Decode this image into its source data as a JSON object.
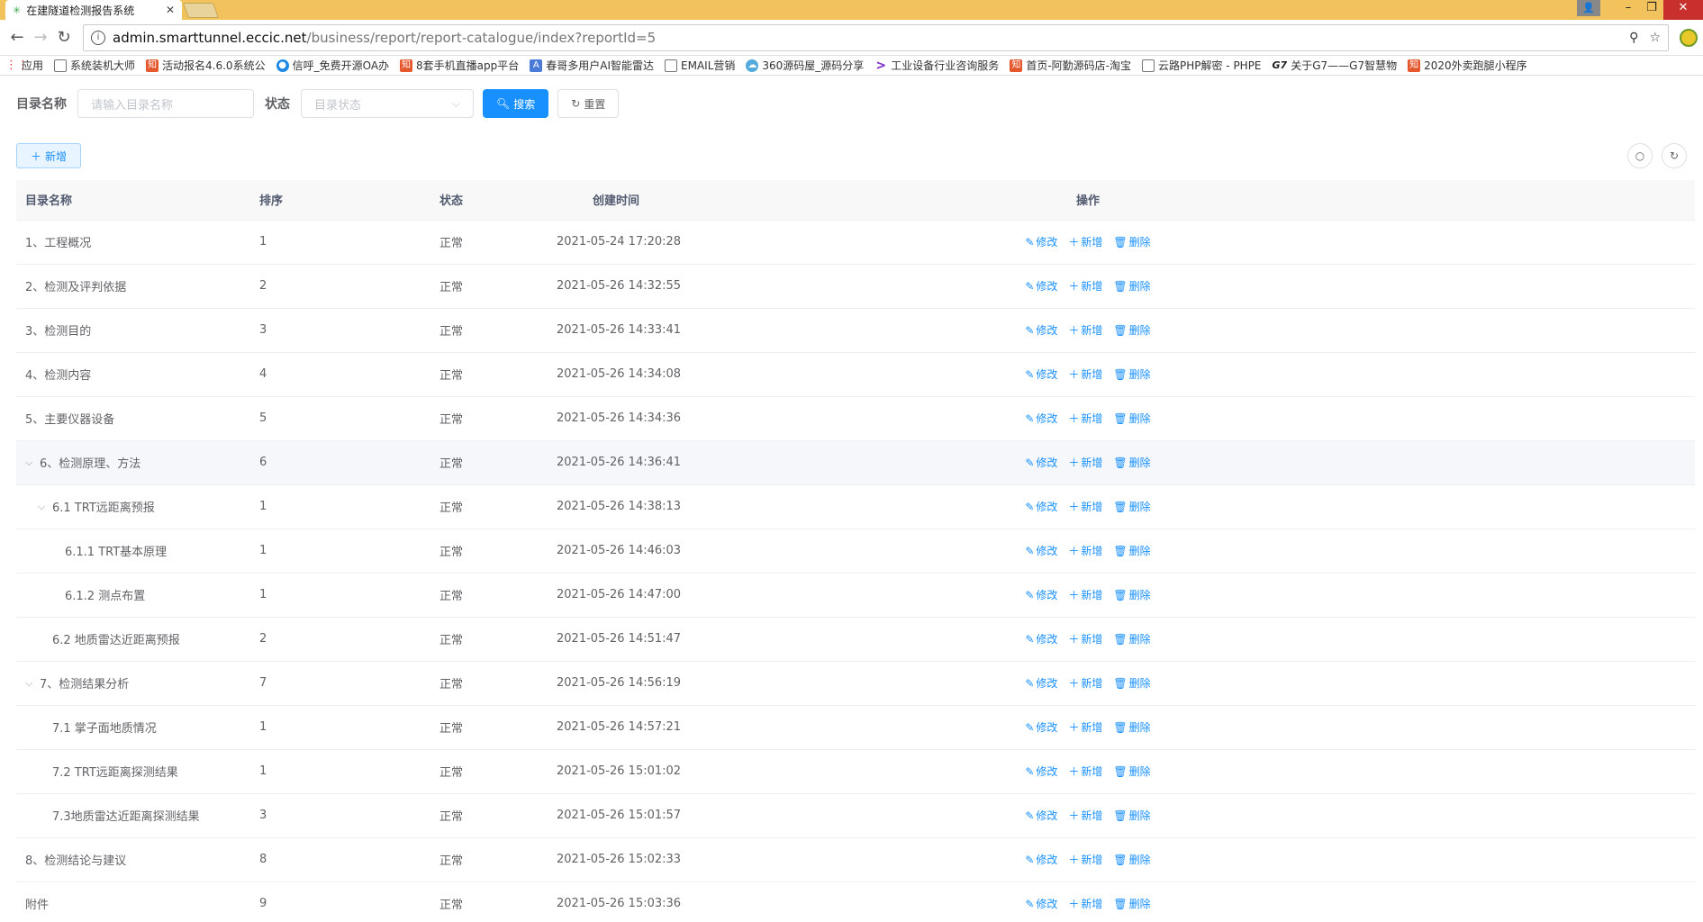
{
  "browser": {
    "tab_title": "在建隧道检测报告系统",
    "url_host": "admin.smarttunnel.eccic.net",
    "url_path": "/business/report/report-catalogue/index?reportId=5",
    "bookmarks": [
      {
        "icon": "apps-icon",
        "label": "应用"
      },
      {
        "icon": "page-icon",
        "label": "系统装机大师"
      },
      {
        "icon": "zhi-icon",
        "label": "活动报名4.6.0系统公"
      },
      {
        "icon": "chat-icon",
        "label": "信呼_免费开源OA办"
      },
      {
        "icon": "zhi-icon",
        "label": "8套手机直播app平台"
      },
      {
        "icon": "app-icon",
        "label": "春哥多用户AI智能雷达"
      },
      {
        "icon": "page-icon",
        "label": "EMAIL营销"
      },
      {
        "icon": "cloud-icon",
        "label": "360源码屋_源码分享"
      },
      {
        "icon": "arrow-icon",
        "label": "工业设备行业咨询服务"
      },
      {
        "icon": "zhi-icon",
        "label": "首页-阿勤源码店-淘宝"
      },
      {
        "icon": "page-icon",
        "label": "云路PHP解密 - PHPE"
      },
      {
        "icon": "g7-icon",
        "label": "关于G7——G7智慧物"
      },
      {
        "icon": "zhi-icon",
        "label": "2020外卖跑腿小程序"
      }
    ]
  },
  "search": {
    "name_label": "目录名称",
    "name_placeholder": "请输入目录名称",
    "status_label": "状态",
    "status_placeholder": "目录状态",
    "search_button": "搜索",
    "reset_button": "重置"
  },
  "toolbar": {
    "add_button": "新增"
  },
  "table": {
    "headers": [
      "目录名称",
      "排序",
      "状态",
      "创建时间",
      "操作"
    ],
    "action_labels": {
      "edit": "修改",
      "add": "新增",
      "delete": "删除"
    },
    "rows": [
      {
        "name": "1、工程概况",
        "order": "1",
        "status": "正常",
        "created": "2021-05-24 17:20:28",
        "level": 0,
        "expand": ""
      },
      {
        "name": "2、检测及评判依据",
        "order": "2",
        "status": "正常",
        "created": "2021-05-26 14:32:55",
        "level": 0,
        "expand": ""
      },
      {
        "name": "3、检测目的",
        "order": "3",
        "status": "正常",
        "created": "2021-05-26 14:33:41",
        "level": 0,
        "expand": ""
      },
      {
        "name": "4、检测内容",
        "order": "4",
        "status": "正常",
        "created": "2021-05-26 14:34:08",
        "level": 0,
        "expand": ""
      },
      {
        "name": "5、主要仪器设备",
        "order": "5",
        "status": "正常",
        "created": "2021-05-26 14:34:36",
        "level": 0,
        "expand": ""
      },
      {
        "name": "6、检测原理、方法",
        "order": "6",
        "status": "正常",
        "created": "2021-05-26 14:36:41",
        "level": 0,
        "expand": "v",
        "highlight": true
      },
      {
        "name": "6.1 TRT远距离预报",
        "order": "1",
        "status": "正常",
        "created": "2021-05-26 14:38:13",
        "level": 1,
        "expand": "v"
      },
      {
        "name": "6.1.1 TRT基本原理",
        "order": "1",
        "status": "正常",
        "created": "2021-05-26 14:46:03",
        "level": 2,
        "expand": ""
      },
      {
        "name": "6.1.2 测点布置",
        "order": "1",
        "status": "正常",
        "created": "2021-05-26 14:47:00",
        "level": 2,
        "expand": ""
      },
      {
        "name": "6.2 地质雷达近距离预报",
        "order": "2",
        "status": "正常",
        "created": "2021-05-26 14:51:47",
        "level": 1,
        "expand": ""
      },
      {
        "name": "7、检测结果分析",
        "order": "7",
        "status": "正常",
        "created": "2021-05-26 14:56:19",
        "level": 0,
        "expand": "v"
      },
      {
        "name": "7.1 掌子面地质情况",
        "order": "1",
        "status": "正常",
        "created": "2021-05-26 14:57:21",
        "level": 1,
        "expand": ""
      },
      {
        "name": "7.2 TRT远距离探测结果",
        "order": "1",
        "status": "正常",
        "created": "2021-05-26 15:01:02",
        "level": 1,
        "expand": ""
      },
      {
        "name": "7.3地质雷达近距离探测结果",
        "order": "3",
        "status": "正常",
        "created": "2021-05-26 15:01:57",
        "level": 1,
        "expand": ""
      },
      {
        "name": "8、检测结论与建议",
        "order": "8",
        "status": "正常",
        "created": "2021-05-26 15:02:33",
        "level": 0,
        "expand": ""
      },
      {
        "name": "附件",
        "order": "9",
        "status": "正常",
        "created": "2021-05-26 15:03:36",
        "level": 0,
        "expand": ""
      }
    ]
  },
  "colors": {
    "primary": "#1890ff",
    "chrome": "#f2c35c"
  }
}
